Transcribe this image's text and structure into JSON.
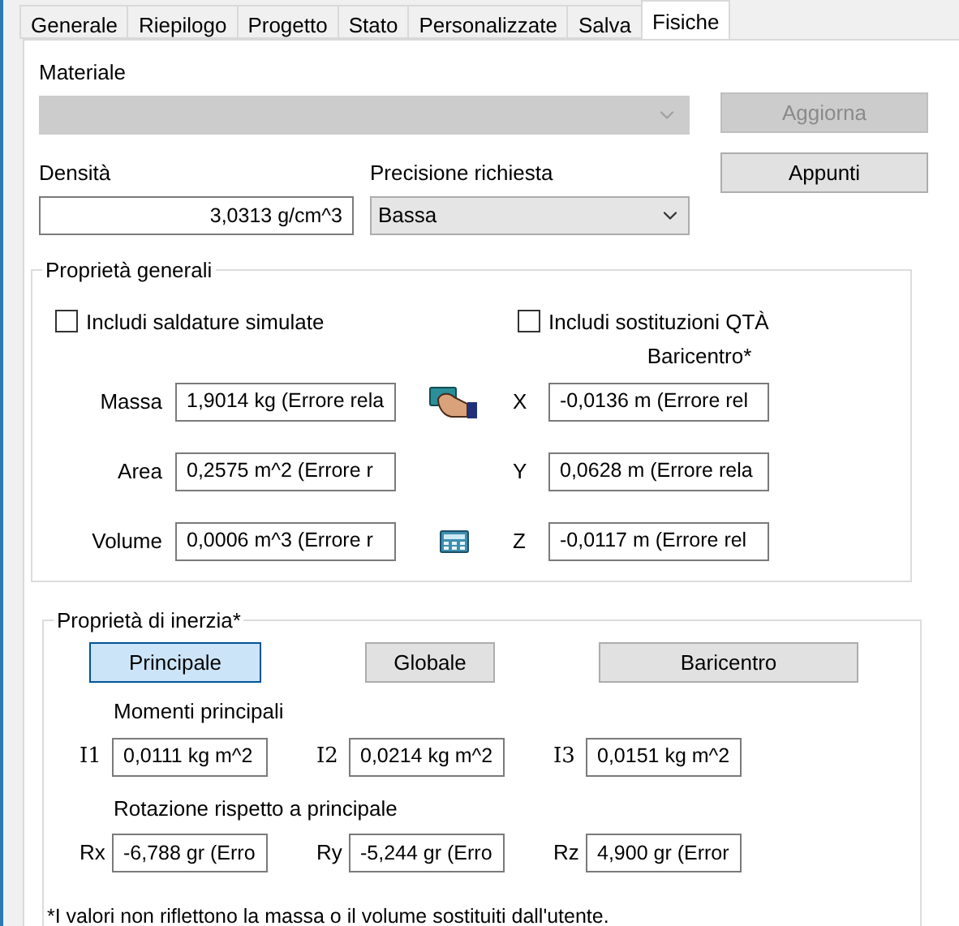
{
  "tabs": [
    {
      "label": "Generale",
      "selected": false
    },
    {
      "label": "Riepilogo",
      "selected": false
    },
    {
      "label": "Progetto",
      "selected": false
    },
    {
      "label": "Stato",
      "selected": false
    },
    {
      "label": "Personalizzate",
      "selected": false
    },
    {
      "label": "Salva",
      "selected": false
    },
    {
      "label": "Fisiche",
      "selected": true
    }
  ],
  "material": {
    "label": "Materiale",
    "disabled": true
  },
  "buttons": [
    {
      "label": "Aggiorna",
      "disabled": true
    },
    {
      "label": "Appunti",
      "disabled": false
    }
  ],
  "density": {
    "label": "Densità",
    "value": "3,0313 g/cm^3"
  },
  "precision": {
    "label": "Precisione richiesta",
    "value": "Bassa"
  },
  "general": {
    "title": "Proprietà generali",
    "checkboxes": [
      {
        "label": "Includi saldature simulate",
        "checked": false
      },
      {
        "label": "Includi sostituzioni QTÀ",
        "checked": false
      }
    ],
    "center_label": "Baricentro*",
    "rows": [
      {
        "label": "Massa",
        "value": "1,9014 kg (Errore rela",
        "axis_label": "X",
        "axis_value": "-0,0136 m (Errore rel"
      },
      {
        "label": "Area",
        "value": "0,2575 m^2 (Errore r",
        "axis_label": "Y",
        "axis_value": "0,0628 m (Errore rela"
      },
      {
        "label": "Volume",
        "value": "0,0006 m^3 (Errore r",
        "axis_label": "Z",
        "axis_value": "-0,0117 m (Errore rel"
      }
    ]
  },
  "inertia": {
    "title": "Proprietà di inerzia*",
    "views": [
      {
        "label": "Principale",
        "selected": true
      },
      {
        "label": "Globale",
        "selected": false
      },
      {
        "label": "Baricentro",
        "selected": false
      }
    ],
    "moments_label": "Momenti principali",
    "moments": [
      {
        "label": "I1",
        "value": "0,0111 kg m^2"
      },
      {
        "label": "I2",
        "value": "0,0214 kg m^2"
      },
      {
        "label": "I3",
        "value": "0,0151 kg m^2"
      }
    ],
    "rotation_label": "Rotazione rispetto a principale",
    "rotations": [
      {
        "label": "Rx",
        "value": "-6,788 gr (Erro"
      },
      {
        "label": "Ry",
        "value": "-5,244 gr (Erro"
      },
      {
        "label": "Rz",
        "value": "4,900 gr (Error"
      }
    ],
    "footnote": "*I valori non riflettono la massa o il volume sostituiti dall'utente."
  }
}
